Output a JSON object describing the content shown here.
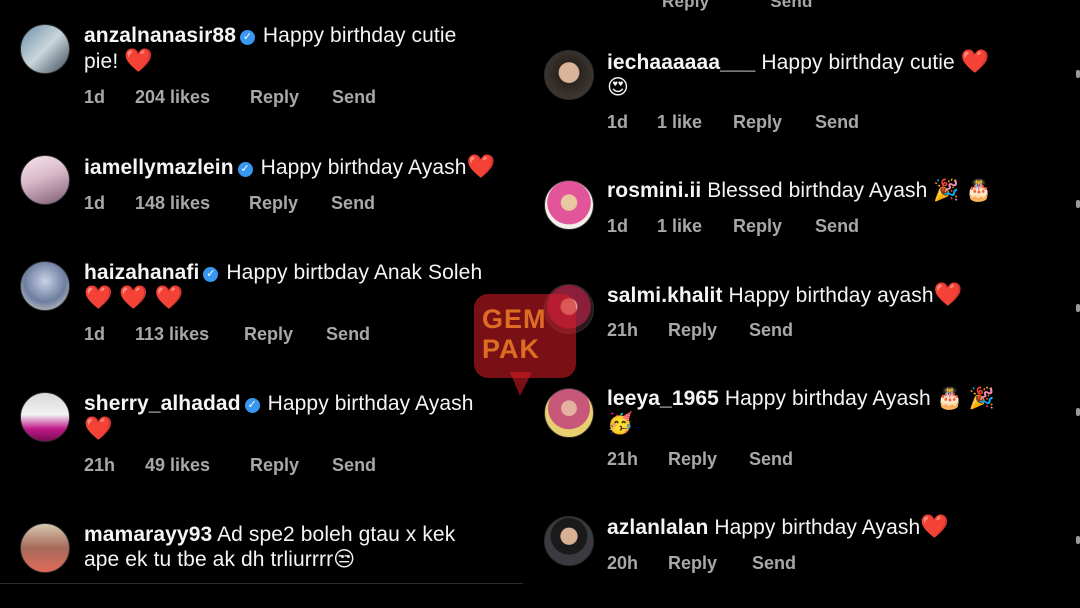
{
  "top_cut": {
    "reply": "Reply",
    "send": "Send"
  },
  "watermark": "GEMPAK",
  "left_comments": [
    {
      "user": "anzalnanasir88",
      "verified": true,
      "text": "Happy birthday cutie",
      "line2": "pie!",
      "emoji": "❤️",
      "time": "1d",
      "likes": "204 likes",
      "reply": "Reply",
      "send": "Send"
    },
    {
      "user": "iamellymazlein",
      "verified": true,
      "text": "Happy birthday Ayash",
      "emoji": "❤️",
      "time": "1d",
      "likes": "148 likes",
      "reply": "Reply",
      "send": "Send"
    },
    {
      "user": "haizahanafi",
      "verified": true,
      "text": "Happy birtbday Anak Soleh",
      "emoji": "❤️ ❤️ ❤️",
      "time": "1d",
      "likes": "113 likes",
      "reply": "Reply",
      "send": "Send"
    },
    {
      "user": "sherry_alhadad",
      "verified": true,
      "text": "Happy birthday Ayash",
      "emoji": "❤️",
      "time": "21h",
      "likes": "49 likes",
      "reply": "Reply",
      "send": "Send"
    },
    {
      "user": "mamarayy93",
      "verified": false,
      "text": "Ad spe2 boleh gtau x kek",
      "line2": "ape ek tu tbe ak dh trliurrrr",
      "emoji": "😒"
    }
  ],
  "right_comments": [
    {
      "user": "iechaaaaaa___",
      "text": "Happy birthday cutie",
      "emoji": "❤️",
      "emoji2": "😍",
      "time": "1d",
      "likes": "1 like",
      "reply": "Reply",
      "send": "Send"
    },
    {
      "user": "rosmini.ii",
      "text": "Blessed birthday Ayash",
      "emoji": "🎉 🎂",
      "time": "1d",
      "likes": "1 like",
      "reply": "Reply",
      "send": "Send"
    },
    {
      "user": "salmi.khalit",
      "text": "Happy birthday ayash",
      "emoji": "❤️",
      "time": "21h",
      "reply": "Reply",
      "send": "Send"
    },
    {
      "user": "leeya_1965",
      "text": "Happy birthday Ayash",
      "emoji": "🎂 🎉",
      "emoji2": "🥳",
      "time": "21h",
      "reply": "Reply",
      "send": "Send"
    },
    {
      "user": "azlanlalan",
      "text": "Happy birthday Ayash",
      "emoji": "❤️",
      "time": "20h",
      "reply": "Reply",
      "send": "Send"
    }
  ],
  "colors": {
    "background": "#000000",
    "text": "#f5f5f5",
    "meta": "#a8a8a8",
    "verified": "#3897f0",
    "heart": "#ed1c24"
  }
}
